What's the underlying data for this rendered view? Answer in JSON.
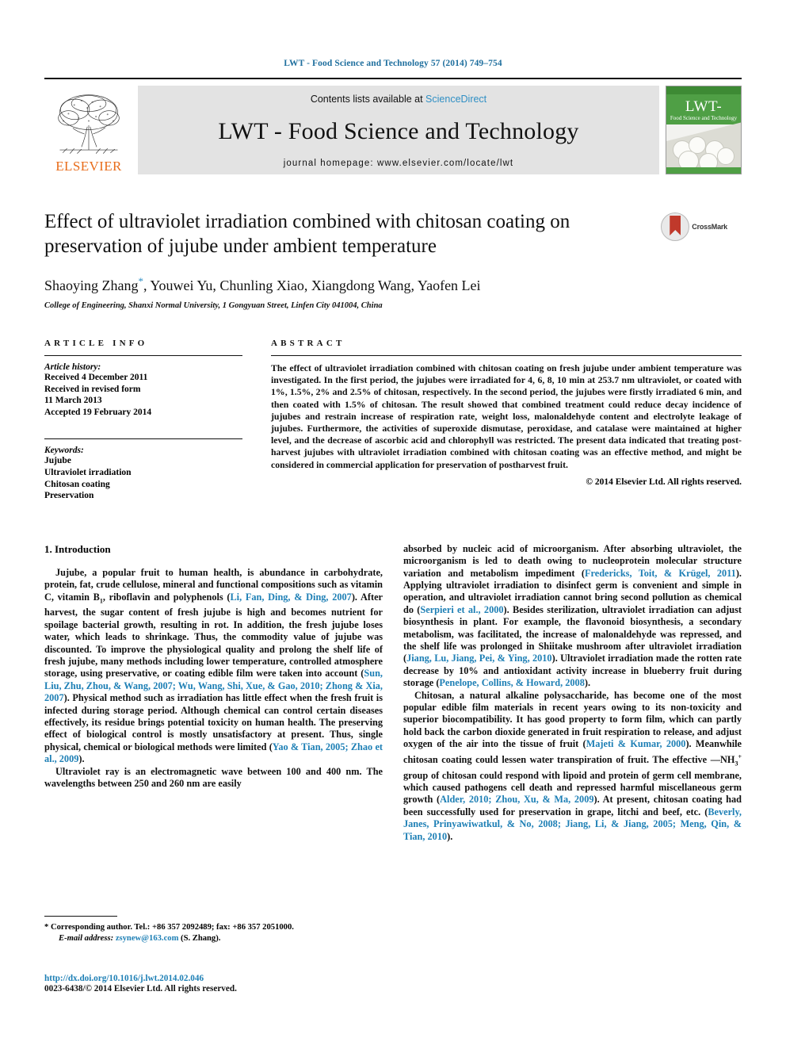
{
  "running_head": "LWT - Food Science and Technology 57 (2014) 749–754",
  "banner": {
    "contents_prefix": "Contents lists available at ",
    "sciencedirect": "ScienceDirect",
    "journal_title": "LWT - Food Science and Technology",
    "homepage": "journal homepage: www.elsevier.com/locate/lwt",
    "publisher_name": "ELSEVIER",
    "cover": {
      "lwt": "LWT-",
      "subtitle": "Food Science and Technology"
    }
  },
  "article": {
    "title": "Effect of ultraviolet irradiation combined with chitosan coating on preservation of jujube under ambient temperature",
    "authors": "Shaoying Zhang",
    "authors_rest": ", Youwei Yu, Chunling Xiao, Xiangdong Wang, Yaofen Lei",
    "corresponding_marker": "*",
    "affiliation": "College of Engineering, Shanxi Normal University, 1 Gongyuan Street, Linfen City 041004, China",
    "crossmark_label": "CrossMark"
  },
  "info": {
    "heading": "ARTICLE INFO",
    "history_label": "Article history:",
    "history": [
      "Received 4 December 2011",
      "Received in revised form",
      "11 March 2013",
      "Accepted 19 February 2014"
    ],
    "keywords_label": "Keywords:",
    "keywords": [
      "Jujube",
      "Ultraviolet irradiation",
      "Chitosan coating",
      "Preservation"
    ]
  },
  "abstract": {
    "heading": "ABSTRACT",
    "text": "The effect of ultraviolet irradiation combined with chitosan coating on fresh jujube under ambient temperature was investigated. In the first period, the jujubes were irradiated for 4, 6, 8, 10 min at 253.7 nm ultraviolet, or coated with 1%, 1.5%, 2% and 2.5% of chitosan, respectively. In the second period, the jujubes were firstly irradiated 6 min, and then coated with 1.5% of chitosan. The result showed that combined treatment could reduce decay incidence of jujubes and restrain increase of respiration rate, weight loss, malonaldehyde content and electrolyte leakage of jujubes. Furthermore, the activities of superoxide dismutase, peroxidase, and catalase were maintained at higher level, and the decrease of ascorbic acid and chlorophyll was restricted. The present data indicated that treating post-harvest jujubes with ultraviolet irradiation combined with chitosan coating was an effective method, and might be considered in commercial application for preservation of postharvest fruit.",
    "copyright": "© 2014 Elsevier Ltd. All rights reserved."
  },
  "body": {
    "section_number_title": "1. Introduction",
    "left_para1_a": "Jujube, a popular fruit to human health, is abundance in carbohydrate, protein, fat, crude cellulose, mineral and functional compositions such as vitamin C, vitamin B",
    "left_para1_sub": "1",
    "left_para1_b": ", riboflavin and polyphenols (",
    "left_ref1": "Li, Fan, Ding, & Ding, 2007",
    "left_para1_c": "). After harvest, the sugar content of fresh jujube is high and becomes nutrient for spoilage bacterial growth, resulting in rot. In addition, the fresh jujube loses water, which leads to shrinkage. Thus, the commodity value of jujube was discounted. To improve the physiological quality and prolong the shelf life of fresh jujube, many methods including lower temperature, controlled atmosphere storage, using preservative, or coating edible film were taken into account (",
    "left_ref2": "Sun, Liu, Zhu, Zhou, & Wang, 2007; Wu, Wang, Shi, Xue, & Gao, 2010; Zhong & Xia, 2007",
    "left_para1_d": "). Physical method such as irradiation has little effect when the fresh fruit is infected during storage period. Although chemical can control certain diseases effectively, its residue brings potential toxicity on human health. The preserving effect of biological control is mostly unsatisfactory at present. Thus, single physical, chemical or biological methods were limited (",
    "left_ref3": "Yao & Tian, 2005; Zhao et al., 2009",
    "left_para1_e": ").",
    "left_para2": "Ultraviolet ray is an electromagnetic wave between 100 and 400 nm. The wavelengths between 250 and 260 nm are easily",
    "right_para1_a": "absorbed by nucleic acid of microorganism. After absorbing ultraviolet, the microorganism is led to death owing to nucleoprotein molecular structure variation and metabolism impediment (",
    "right_ref1": "Fredericks, Toit, & Krügel, 2011",
    "right_para1_b": "). Applying ultraviolet irradiation to disinfect germ is convenient and simple in operation, and ultraviolet irradiation cannot bring second pollution as chemical do (",
    "right_ref2": "Serpieri et al., 2000",
    "right_para1_c": "). Besides sterilization, ultraviolet irradiation can adjust biosynthesis in plant. For example, the flavonoid biosynthesis, a secondary metabolism, was facilitated, the increase of malonaldehyde was repressed, and the shelf life was prolonged in Shiitake mushroom after ultraviolet irradiation (",
    "right_ref3": "Jiang, Lu, Jiang, Pei, & Ying, 2010",
    "right_para1_d": "). Ultraviolet irradiation made the rotten rate decrease by 10% and antioxidant activity increase in blueberry fruit during storage (",
    "right_ref4": "Penelope, Collins, & Howard, 2008",
    "right_para1_e": ").",
    "right_para2_a": "Chitosan, a natural alkaline polysaccharide, has become one of the most popular edible film materials in recent years owing to its non-toxicity and superior biocompatibility. It has good property to form film, which can partly hold back the carbon dioxide generated in fruit respiration to release, and adjust oxygen of the air into the tissue of fruit (",
    "right_ref5": "Majeti & Kumar, 2000",
    "right_para2_b": "). Meanwhile chitosan coating could lessen water transpiration of fruit. The effective —NH",
    "right_para2_sub": "3",
    "right_para2_sup": "+",
    "right_para2_c": " group of chitosan could respond with lipoid and protein of germ cell membrane, which caused pathogens cell death and repressed harmful miscellaneous germ growth (",
    "right_ref6": "Alder, 2010; Zhou, Xu, & Ma, 2009",
    "right_para2_d": "). At present, chitosan coating had been successfully used for preservation in grape, litchi and beef, etc. (",
    "right_ref7": "Beverly, Janes, Prinyawiwatkul, & No, 2008; Jiang, Li, & Jiang, 2005; Meng, Qin, & Tian, 2010",
    "right_para2_e": ")."
  },
  "footnote": {
    "corresponding": "* Corresponding author. Tel.: +86 357 2092489; fax: +86 357 2051000.",
    "email_label": "E-mail address:",
    "email": "zsynew@163.com",
    "email_owner": " (S. Zhang)."
  },
  "footer": {
    "doi": "http://dx.doi.org/10.1016/j.lwt.2014.02.046",
    "issn_line": "0023-6438/© 2014 Elsevier Ltd. All rights reserved."
  },
  "colors": {
    "link": "#1d7fb5",
    "sciencedirect": "#2f8fc4",
    "elsevier_orange": "#E86C1A",
    "banner_bg": "#e3e3e3",
    "cover_green": "#4f9f45"
  }
}
